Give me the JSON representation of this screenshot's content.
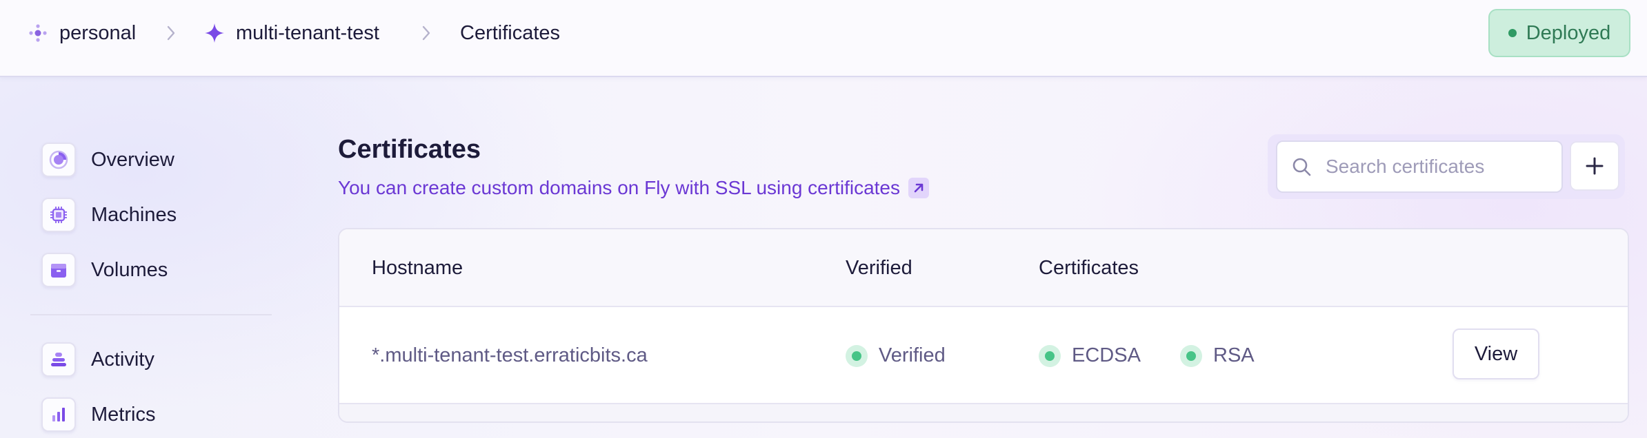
{
  "breadcrumb": {
    "org": "personal",
    "app": "multi-tenant-test",
    "page": "Certificates"
  },
  "status": {
    "label": "Deployed",
    "color": "#2f9a63"
  },
  "sidebar": {
    "items": [
      {
        "label": "Overview",
        "icon": "overview-icon"
      },
      {
        "label": "Machines",
        "icon": "chip-icon"
      },
      {
        "label": "Volumes",
        "icon": "box-icon"
      },
      {
        "label": "Activity",
        "icon": "stack-icon"
      },
      {
        "label": "Metrics",
        "icon": "bar-chart-icon"
      }
    ]
  },
  "main": {
    "title": "Certificates",
    "subtitle": "You can create custom domains on Fly with SSL using certificates",
    "accent": "#6b38d4"
  },
  "search": {
    "placeholder": "Search certificates",
    "value": ""
  },
  "table": {
    "headers": [
      "Hostname",
      "Verified",
      "Certificates"
    ],
    "rows": [
      {
        "hostname": "*.multi-tenant-test.erraticbits.ca",
        "verified": "Verified",
        "cert_types": [
          "ECDSA",
          "RSA"
        ],
        "action": "View"
      }
    ]
  }
}
